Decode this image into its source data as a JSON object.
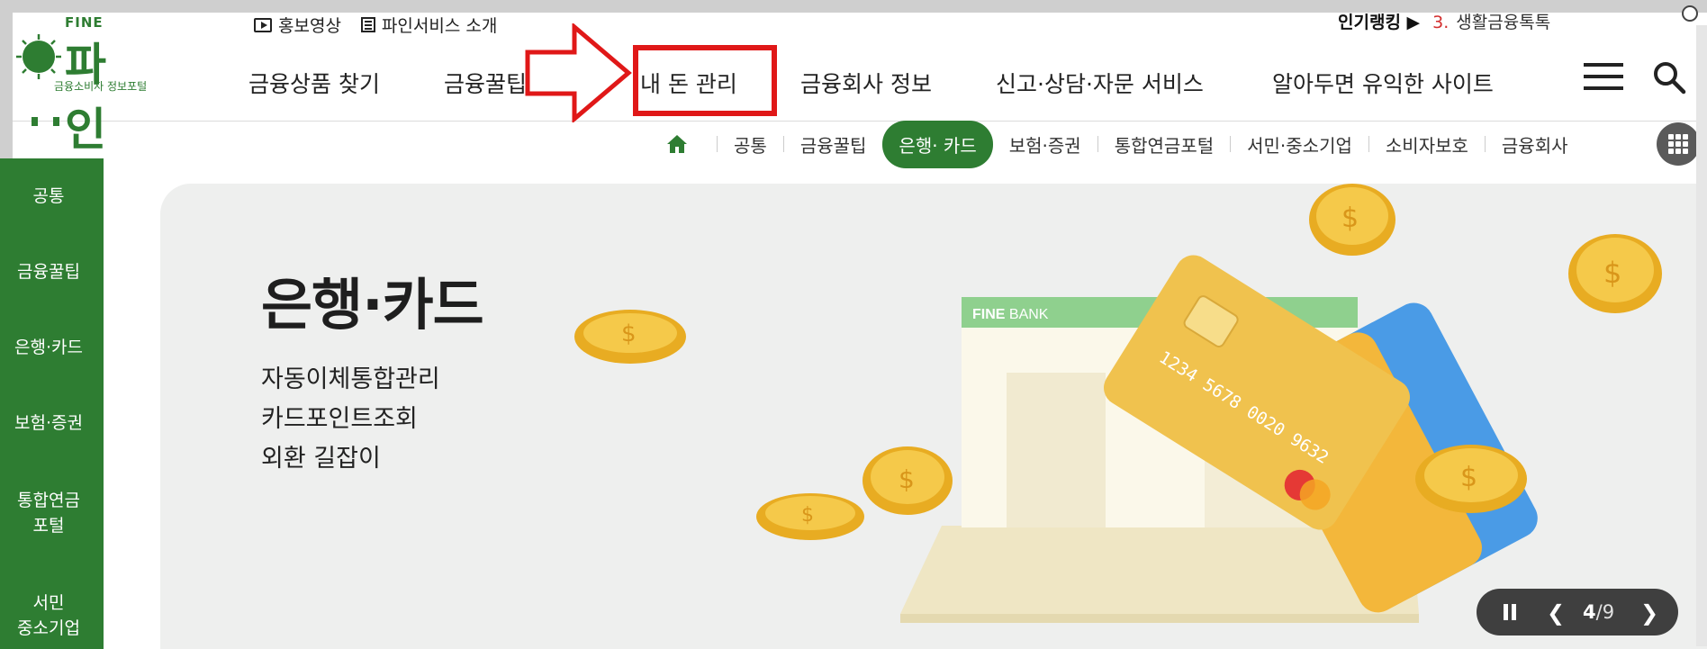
{
  "logo": {
    "fine": "FINE",
    "name": "파 인",
    "sub": "금융소비자 정보포털"
  },
  "utility": {
    "video": "홍보영상",
    "service": "파인서비스 소개"
  },
  "ranking": {
    "label": "인기랭킹 ▶",
    "rank": "3.",
    "topic": "생활금융톡톡"
  },
  "gnb": [
    "금융상품 찾기",
    "금융꿀팁 찾기",
    "내 돈 관리",
    "금융회사 정보",
    "신고·상담·자문 서비스",
    "알아두면 유익한 사이트"
  ],
  "subnav": {
    "items": [
      "공통",
      "금융꿀팁",
      "은행· 카드",
      "보험·증권",
      "통합연금포털",
      "서민·중소기업",
      "소비자보호",
      "금융회사"
    ],
    "active_index": 2
  },
  "sidenav": [
    "공통",
    "금융꿀팁",
    "은행·카드",
    "보험·증권",
    "통합연금\n포털",
    "서민\n중소기업"
  ],
  "hero": {
    "title": "은행·카드",
    "links": [
      "자동이체통합관리",
      "카드포인트조회",
      "외환 길잡이"
    ],
    "bank_label_bold": "FINE",
    "bank_label": " BANK",
    "card_number": "1234 5678 0020 9632"
  },
  "slider": {
    "current": "4",
    "separator": "/",
    "total": "9"
  },
  "colors": {
    "brand_green": "#2e7d32",
    "highlight_red": "#e01818",
    "hero_bg": "#eeefee"
  }
}
